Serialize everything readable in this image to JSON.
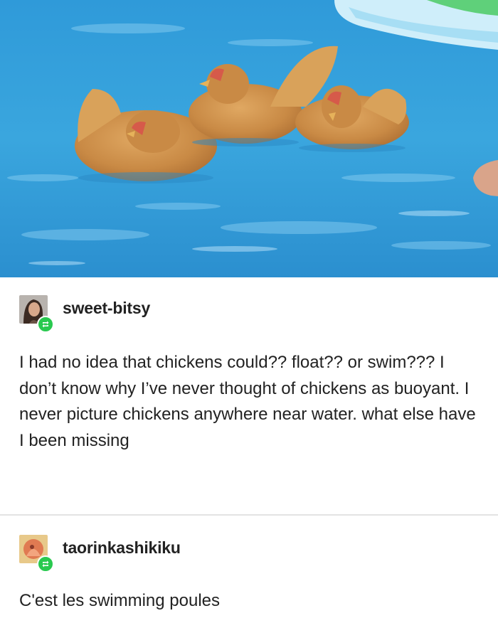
{
  "photo": {
    "subject": "three-chickens-swimming-in-pool",
    "water_color": "#3aa6de"
  },
  "posts": [
    {
      "username": "sweet-bitsy",
      "avatar": "user-avatar",
      "reblog_icon": "reblog-icon",
      "text": "I had no idea that chickens could?? float?? or swim??? I don’t know why I’ve never thought of chickens as buoyant. I never picture chickens anywhere near water. what else have I been missing"
    },
    {
      "username": "taorinkashikiku",
      "avatar": "user-avatar",
      "reblog_icon": "reblog-icon",
      "text": "C'est les swimming poules"
    }
  ],
  "colors": {
    "reblog_green": "#29c94f",
    "text": "#222222",
    "divider": "#e3e3e3"
  }
}
